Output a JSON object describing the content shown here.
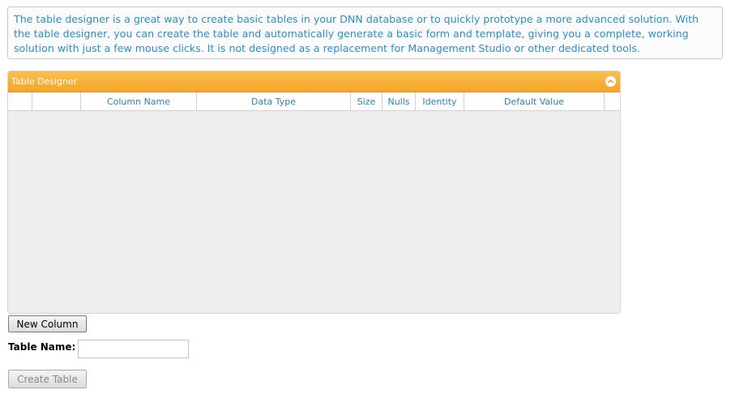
{
  "info": {
    "text": "The table designer is a great way to create basic tables in your DNN database or to quickly prototype a more advanced solution. With the table designer, you can create the table and automatically generate a basic form and template, giving you a complete, working solution with just a few mouse clicks. It is not designed as a replacement for Management Studio or other dedicated tools."
  },
  "panel": {
    "title": "Table Designer",
    "collapse_icon": "chevron-up-icon",
    "columns": [
      "",
      "",
      "Column Name",
      "Data Type",
      "Size",
      "Nulls",
      "Identity",
      "Default Value",
      ""
    ]
  },
  "actions": {
    "new_column_label": "New Column",
    "table_name_label": "Table Name:",
    "table_name_value": "",
    "create_table_label": "Create Table"
  },
  "colors": {
    "info_text": "#2b8fc7",
    "header_gradient_top": "#f9c04f",
    "header_gradient_bottom": "#f3a529",
    "column_header_text": "#2b7fb5"
  }
}
